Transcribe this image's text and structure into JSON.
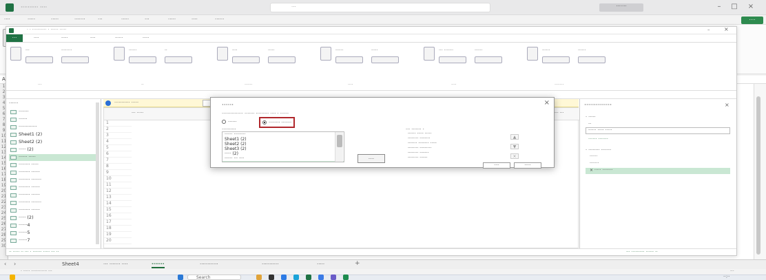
{
  "window": {
    "title": "·········· ····"
  },
  "titlebar": {
    "search_placeholder": "···"
  },
  "excel_tabs": [
    "····",
    "·····",
    "·····",
    "·······",
    "···",
    "·····",
    "···",
    "·····",
    "····",
    "······"
  ],
  "share_label": "····",
  "namebox": "A1",
  "powerquery": {
    "window_title": "· · ··········· · ······ ·····",
    "tabs": [
      "····",
      "·····",
      "····",
      "······",
      "·····"
    ],
    "file_tab": "···",
    "ribbon_groups": [
      {
        "buttons": [
          "···",
          "········"
        ],
        "label": "···"
      },
      {
        "buttons": [
          "······",
          "··"
        ],
        "label": "··"
      },
      {
        "buttons": [
          "····",
          "·····"
        ],
        "label": "······"
      },
      {
        "buttons": [
          "······",
          "·····"
        ],
        "label": "····"
      },
      {
        "buttons": [
          "··· ·······",
          "······"
        ],
        "label": "····"
      },
      {
        "buttons": [
          "······",
          "······"
        ],
        "label": "·······"
      }
    ],
    "queries_header": "······",
    "queries": [
      {
        "label": "·······",
        "type": "table"
      },
      {
        "label": "······",
        "type": "table"
      },
      {
        "label": "·············",
        "type": "table"
      },
      {
        "label": "Sheet1 (2)",
        "type": "sheet"
      },
      {
        "label": "Sheet2 (2)",
        "type": "sheet"
      },
      {
        "label": "····· (2)",
        "type": "sheet"
      },
      {
        "label": "······ ·····",
        "type": "sheet",
        "selected": true
      },
      {
        "label": "········ ·····",
        "type": "sheet"
      },
      {
        "label": "········ ······",
        "type": "sheet"
      },
      {
        "label": "········ ·······",
        "type": "sheet"
      },
      {
        "label": "········ ······",
        "type": "sheet"
      },
      {
        "label": "········ ······",
        "type": "sheet"
      },
      {
        "label": "········ ·······",
        "type": "sheet"
      },
      {
        "label": "········ ······",
        "type": "sheet"
      },
      {
        "label": "····· (2)",
        "type": "sheet"
      },
      {
        "label": "······4",
        "type": "sheet"
      },
      {
        "label": "······5",
        "type": "sheet"
      },
      {
        "label": "······7",
        "type": "sheet"
      }
    ],
    "warning_text": "··········· ·····",
    "warning_button": "····",
    "column_header": "··· ·····",
    "settings": {
      "title": "··············",
      "properties_label": "· ·····",
      "name_label": "··",
      "name_value": "······ ····· ·····",
      "all_properties": "······ ·······",
      "applied_steps_label": "· ········ ·······",
      "steps": [
        {
          "label": "······",
          "selected": false
        },
        {
          "label": "·······",
          "selected": false
        },
        {
          "label": "× ····· ········",
          "selected": true
        }
      ]
    },
    "status_left": "·· ····· ·· ··· · ······· ····· ··· ··",
    "status_right": "··· ·········· ······ ··"
  },
  "dialog": {
    "title": "······",
    "description": "··············· ······· ········· ···· · ······",
    "radio_one": "······",
    "radio_two": "········ ·······",
    "available_label": "··········",
    "available_items": [
      {
        "label": "······ ·········",
        "selected": false
      },
      {
        "label": "Sheet1 (2)",
        "selected": false
      },
      {
        "label": "Sheet2 (2)",
        "selected": false
      },
      {
        "label": "Sheet3 (2)",
        "selected": false
      },
      {
        "label": "····· (2)",
        "selected": false
      },
      {
        "label": "······ ··· ····",
        "selected": false
      },
      {
        "label": "········· ····",
        "selected": true
      },
      {
        "label": "········ ······ ····",
        "selected": false
      },
      {
        "label": "········· ······ ·····",
        "selected": false
      }
    ],
    "add_button": "····",
    "append_label": "··· ······· ·",
    "append_items": [
      "······ ····· ·····",
      "········ ········",
      "······· ········ ·····",
      "········ ·········",
      "········ ·······",
      "········ ······"
    ],
    "ok_button": "····",
    "cancel_button": "·····"
  },
  "sheet_tabs": [
    {
      "label": "Sheet4",
      "active": false
    },
    {
      "label": "··· ······· ····",
      "active": false
    },
    {
      "label": "·······",
      "active": true
    },
    {
      "label": "············",
      "active": false
    },
    {
      "label": "···········",
      "active": false
    },
    {
      "label": "·····",
      "active": false
    }
  ],
  "status_bar": {
    "left": "· ····· ············ ···",
    "right": "···"
  },
  "taskbar": {
    "search": "Search",
    "time": "··:··"
  }
}
